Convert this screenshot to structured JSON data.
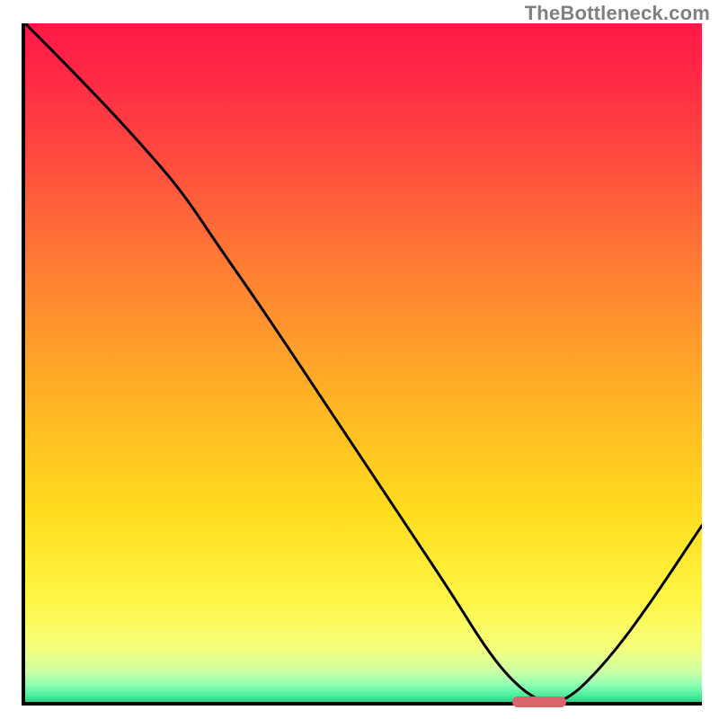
{
  "attribution": "TheBottleneck.com",
  "colors": {
    "axis": "#000000",
    "curve": "#000000",
    "attribution_text": "#808080",
    "marker": "#d9646e"
  },
  "gradient_stops": [
    {
      "offset": 0.0,
      "color": "#ff1846"
    },
    {
      "offset": 0.08,
      "color": "#ff2a45"
    },
    {
      "offset": 0.2,
      "color": "#ff4b3f"
    },
    {
      "offset": 0.35,
      "color": "#ff7a34"
    },
    {
      "offset": 0.55,
      "color": "#ffb225"
    },
    {
      "offset": 0.72,
      "color": "#ffdc1e"
    },
    {
      "offset": 0.85,
      "color": "#fff646"
    },
    {
      "offset": 0.92,
      "color": "#f6ff7c"
    },
    {
      "offset": 0.955,
      "color": "#ceffa4"
    },
    {
      "offset": 0.975,
      "color": "#8dffb3"
    },
    {
      "offset": 0.99,
      "color": "#4cef9d"
    },
    {
      "offset": 1.0,
      "color": "#2bd184"
    }
  ],
  "chart_data": {
    "type": "line",
    "title": "",
    "xlabel": "",
    "ylabel": "",
    "xlim": [
      0,
      100
    ],
    "ylim": [
      0,
      100
    ],
    "grid": false,
    "series": [
      {
        "name": "bottleneck-curve",
        "x": [
          0,
          10,
          20,
          24,
          28,
          35,
          45,
          55,
          63,
          68,
          72,
          76,
          80,
          86,
          92,
          100
        ],
        "y": [
          100,
          90,
          79,
          74,
          68,
          58,
          43,
          28,
          16,
          8,
          3,
          0,
          0,
          6,
          14,
          26
        ]
      }
    ],
    "marker": {
      "x_start": 72,
      "x_end": 80,
      "y": 0
    },
    "note": "x/y are fractions of plot width/height (0=origin at bottom-left). y is distance from bottom axis upward; values estimated from pixels."
  }
}
